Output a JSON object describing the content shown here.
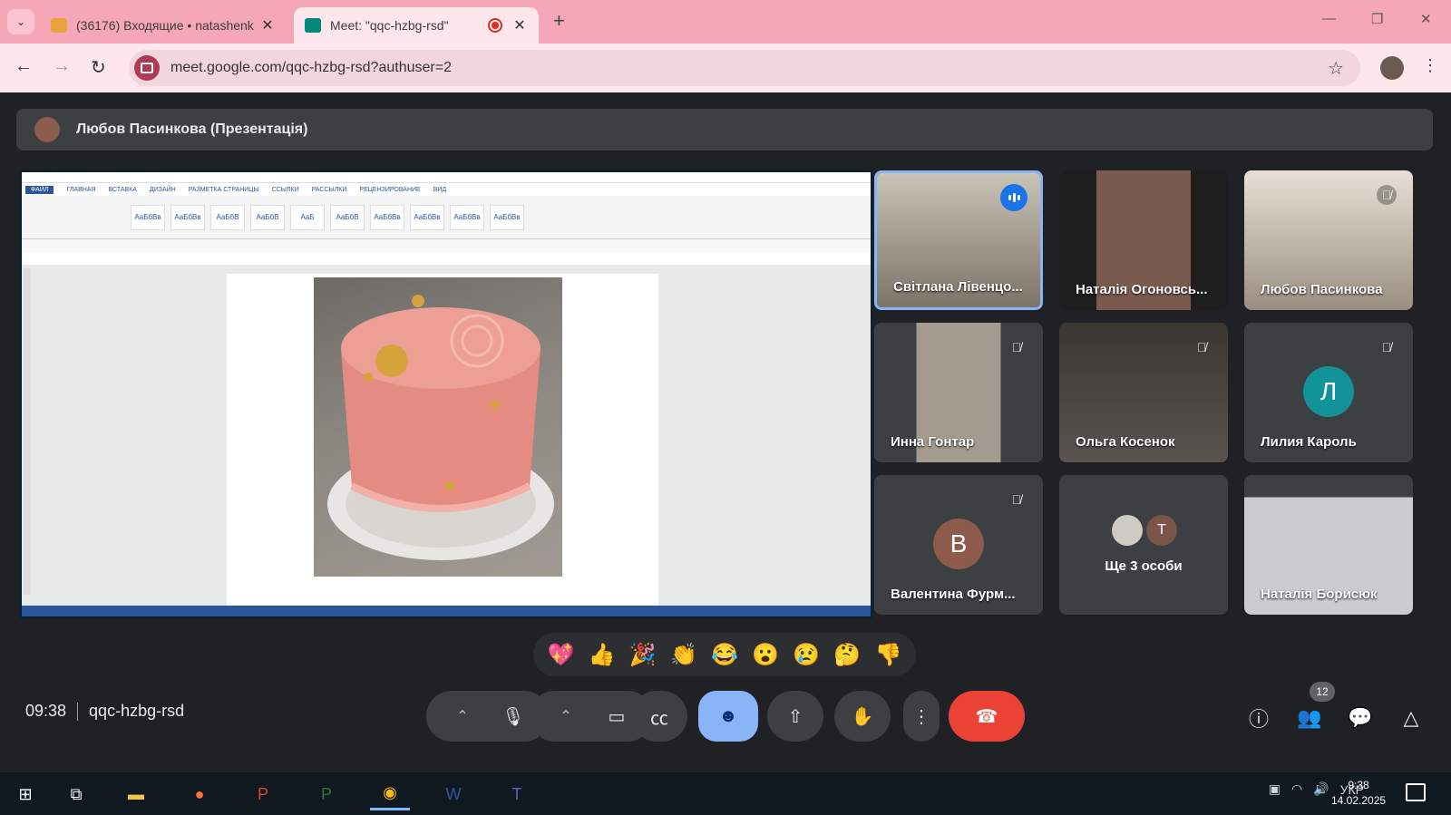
{
  "browser": {
    "tabs": [
      {
        "title": "(36176) Входящие • natashenk",
        "favicon_color": "#d93025",
        "active": false
      },
      {
        "title": "Meet: \"qqc-hzbg-rsd\"",
        "favicon_color": "#00897b",
        "active": true
      }
    ],
    "url": "meet.google.com/qqc-hzbg-rsd?authuser=2",
    "accent": "#f5a7b8"
  },
  "meet": {
    "presenter": "Любов Пасинкова (Презентація)",
    "participants": [
      {
        "name": "Світлана Лівенцо...",
        "speaking": true,
        "muted": false,
        "color": "#8a8378"
      },
      {
        "name": "Наталія Огоновсь...",
        "speaking": false,
        "muted": false,
        "color": "#7a5a4f"
      },
      {
        "name": "Любов Пасинкова",
        "speaking": false,
        "muted": true,
        "color": "#9a8e80"
      },
      {
        "name": "Инна Гонтар",
        "speaking": false,
        "muted": true,
        "color": "#a39a90"
      },
      {
        "name": "Ольга Косенок",
        "speaking": false,
        "muted": true,
        "color": "#5a5450"
      },
      {
        "name": "Лилия Кароль",
        "speaking": false,
        "muted": true,
        "initial": "Л",
        "color": "#12939a"
      },
      {
        "name": "Валентина Фурм...",
        "speaking": false,
        "muted": true,
        "initial": "В",
        "color": "#8d5a4b"
      },
      {
        "name": "Ще 3 особи",
        "initial": "Т",
        "color": "#795548"
      },
      {
        "name": "Наталія Борисюк",
        "speaking": false,
        "muted": false,
        "color": "#b7bcbf"
      }
    ],
    "reactions": [
      "💖",
      "👍",
      "🎉",
      "👏",
      "😂",
      "😮",
      "😢",
      "🤔",
      "👎"
    ],
    "time": "09:38",
    "meeting_code": "qqc-hzbg-rsd",
    "participant_count": "12"
  },
  "word": {
    "tabs": [
      "ФАЙЛ",
      "ГЛАВНАЯ",
      "ВСТАВКА",
      "ДИЗАЙН",
      "РАЗМЕТКА СТРАНИЦЫ",
      "ССЫЛКИ",
      "РАССЫЛКИ",
      "РЕЦЕНЗИРОВАНИЕ",
      "ВИД"
    ],
    "styles": [
      "АаБбВв",
      "АаБбВв",
      "АаБбВ",
      "АаБбВ",
      "AaБ",
      "АаБбВ",
      "АаБбВв",
      "АаБбВв",
      "АаБбВв",
      "АаБбВв"
    ]
  },
  "taskbar": {
    "lang": "УКР",
    "time": "9:38",
    "date": "14.02.2025"
  }
}
